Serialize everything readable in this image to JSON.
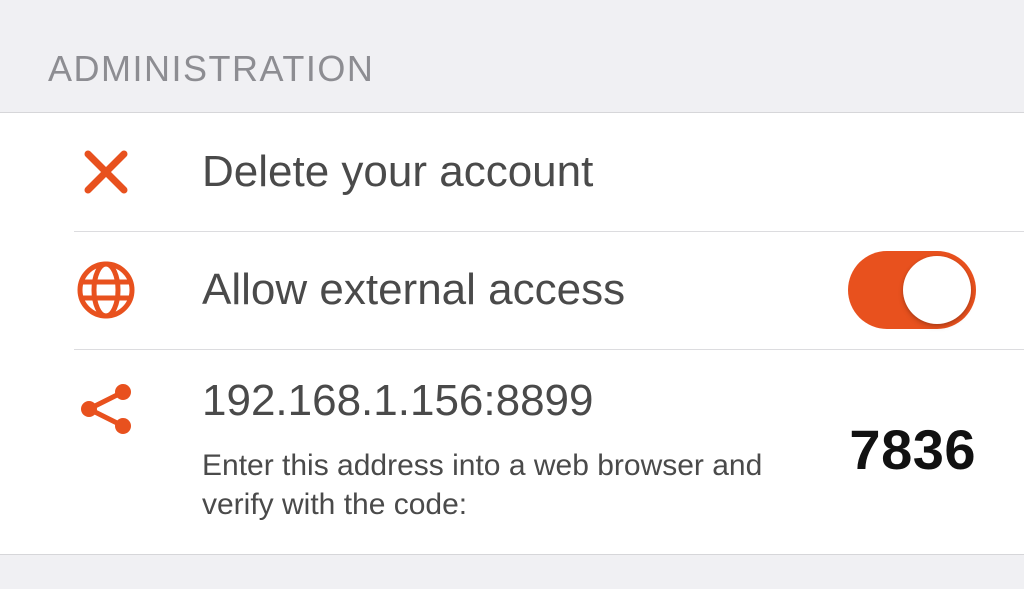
{
  "colors": {
    "accent": "#e8511e"
  },
  "section": {
    "header": "ADMINISTRATION"
  },
  "rows": {
    "delete": {
      "title": "Delete your account"
    },
    "external": {
      "title": "Allow external access",
      "toggle_on": true
    },
    "share": {
      "address": "192.168.1.156:8899",
      "subtext": "Enter this address into a web browser and verify with the code:",
      "code": "7836"
    }
  }
}
